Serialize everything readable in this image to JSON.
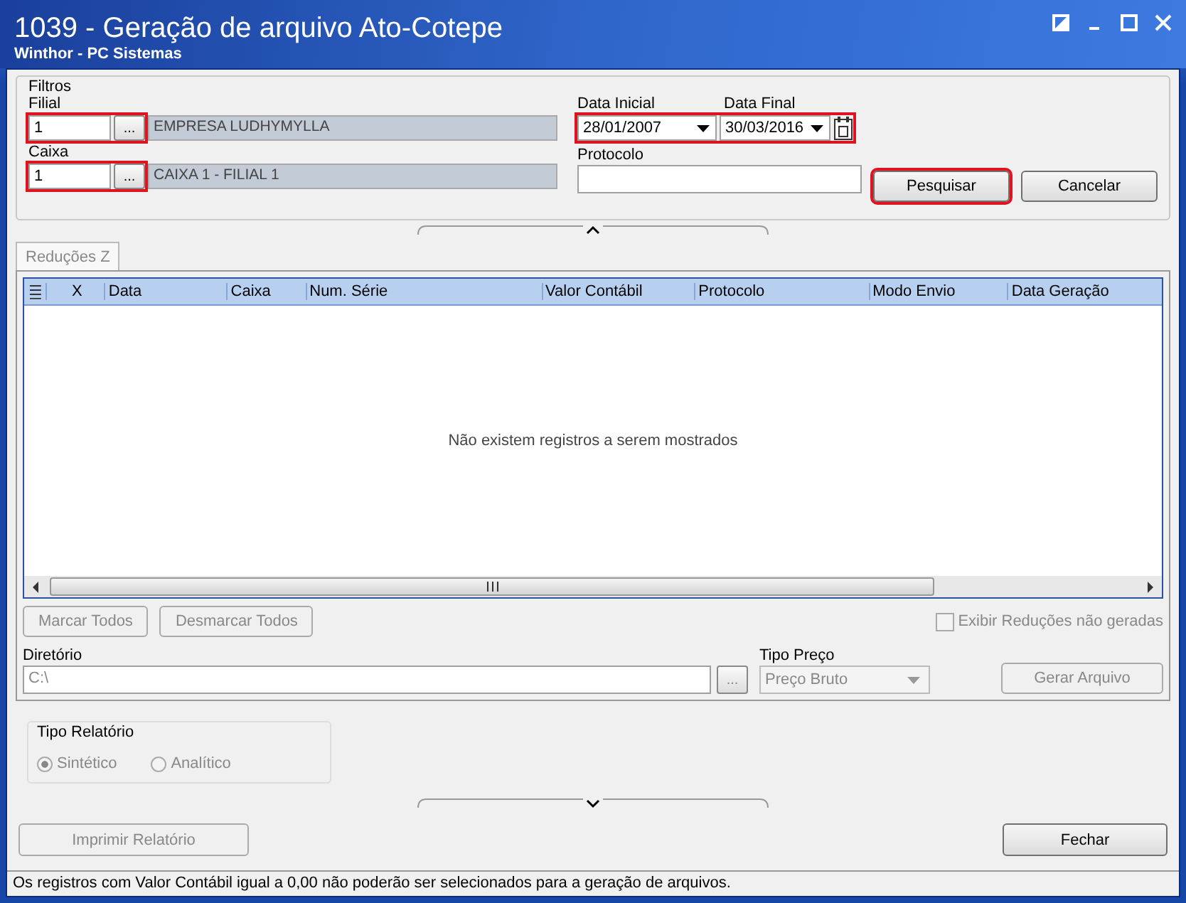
{
  "window": {
    "title": "1039 - Geração de arquivo Ato-Cotepe",
    "subtitle": "Winthor - PC Sistemas"
  },
  "filters": {
    "title": "Filtros",
    "lookups": [
      {
        "label": "Filial",
        "value": "1",
        "button": "...",
        "description": "EMPRESA LUDHYMYLLA",
        "highlighted": true
      },
      {
        "label": "Caixa",
        "value": "1",
        "button": "...",
        "description": "CAIXA 1 - FILIAL 1",
        "highlighted": true
      }
    ],
    "dates": [
      {
        "label": "Data Inicial",
        "value": "28/01/2007"
      },
      {
        "label": "Data Final",
        "value": "30/03/2016"
      }
    ],
    "dates_highlighted": true,
    "protocolo": {
      "label": "Protocolo"
    },
    "buttons": [
      {
        "label": "Pesquisar",
        "highlighted": true
      },
      {
        "label": "Cancelar",
        "highlighted": false
      }
    ]
  },
  "tabs": [
    {
      "label": "Reduções Z",
      "selected": true
    }
  ],
  "table": {
    "columns": [
      "X",
      "Data",
      "Caixa",
      "Num. Série",
      "Valor Contábil",
      "Protocolo",
      "Modo Envio",
      "Data Geração"
    ],
    "empty_message": "Não existem registros a serem mostrados"
  },
  "actions": [
    {
      "label": "Marcar Todos",
      "disabled": true
    },
    {
      "label": "Desmarcar Todos",
      "disabled": true
    }
  ],
  "show_ungenerated": {
    "label": "Exibir Reduções não geradas",
    "checked": false,
    "disabled": true
  },
  "diretorio": {
    "label": "Diretório",
    "value": "C:\\",
    "button": "..."
  },
  "tipo_preco": {
    "label": "Tipo Preço",
    "value": "Preço Bruto"
  },
  "gerar_button": {
    "label": "Gerar Arquivo",
    "disabled": true
  },
  "tipo_relatorio": {
    "title": "Tipo Relatório",
    "options": [
      {
        "label": "Sintético",
        "selected": true
      },
      {
        "label": "Analítico",
        "selected": false
      }
    ]
  },
  "footer_buttons": [
    {
      "label": "Imprimir Relatório",
      "disabled": true
    },
    {
      "label": "Fechar",
      "disabled": false
    }
  ],
  "status_bar": "Os registros com Valor Contábil igual a 0,00 não poderão ser selecionados para a geração de arquivos."
}
